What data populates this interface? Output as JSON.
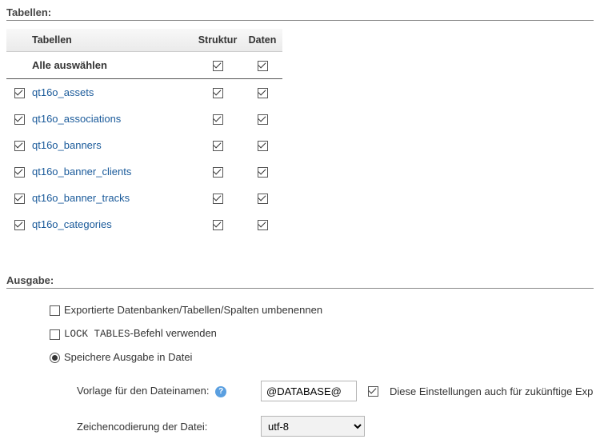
{
  "sections": {
    "tables": "Tabellen:",
    "output": "Ausgabe:"
  },
  "table": {
    "headers": {
      "name": "Tabellen",
      "structure": "Struktur",
      "data": "Daten"
    },
    "select_all": "Alle auswählen",
    "rows": [
      {
        "name": "qt16o_assets"
      },
      {
        "name": "qt16o_associations"
      },
      {
        "name": "qt16o_banners"
      },
      {
        "name": "qt16o_banner_clients"
      },
      {
        "name": "qt16o_banner_tracks"
      },
      {
        "name": "qt16o_categories"
      }
    ]
  },
  "output": {
    "rename": "Exportierte Datenbanken/Tabellen/Spalten umbenennen",
    "lock_prefix": "LOCK TABLES",
    "lock_suffix": "-Befehl verwenden",
    "save_file": "Speichere Ausgabe in Datei",
    "filename_tpl_label": "Vorlage für den Dateinamen:",
    "filename_tpl_value": "@DATABASE@",
    "save_future": "Diese Einstellungen auch für zukünftige Exp",
    "charset_label": "Zeichencodierung der Datei:",
    "charset_value": "utf-8"
  }
}
